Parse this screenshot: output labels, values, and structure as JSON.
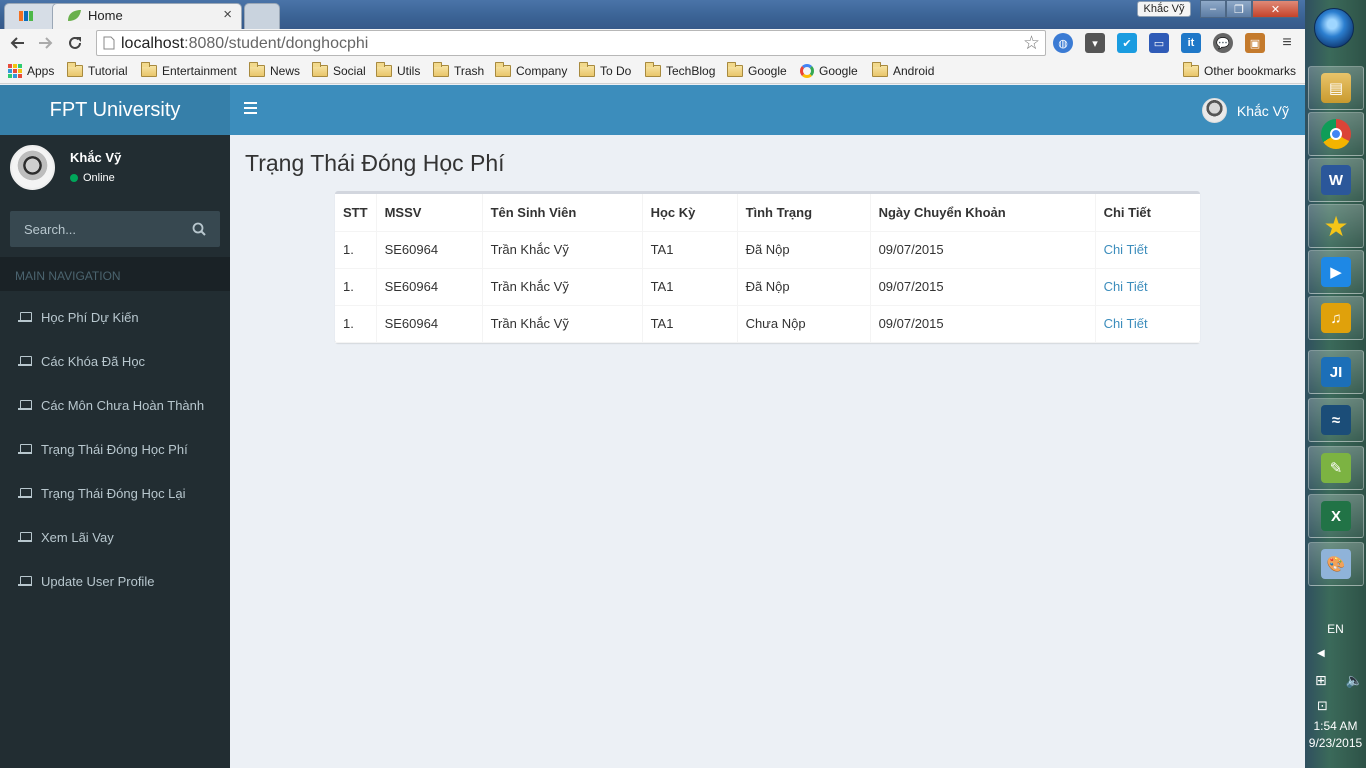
{
  "browser": {
    "tabs": [
      {
        "title": ""
      },
      {
        "title": "Home"
      },
      {
        "title": ""
      }
    ],
    "window_user": "Khắc Vỹ",
    "address": {
      "host": "localhost",
      "rest": ":8080/student/donghocphi"
    },
    "bookmarks": [
      {
        "label": "Apps",
        "icon": "apps-grid-icon"
      },
      {
        "label": "Tutorial",
        "icon": "folder-icon"
      },
      {
        "label": "Entertainment",
        "icon": "folder-icon"
      },
      {
        "label": "News",
        "icon": "folder-icon"
      },
      {
        "label": "Social",
        "icon": "folder-icon"
      },
      {
        "label": "Utils",
        "icon": "folder-icon"
      },
      {
        "label": "Trash",
        "icon": "folder-icon"
      },
      {
        "label": "Company",
        "icon": "folder-icon"
      },
      {
        "label": "To Do",
        "icon": "folder-icon"
      },
      {
        "label": "TechBlog",
        "icon": "folder-icon"
      },
      {
        "label": "Google",
        "icon": "folder-icon"
      },
      {
        "label": "Google",
        "icon": "google-icon"
      },
      {
        "label": "Android",
        "icon": "folder-icon"
      }
    ],
    "other_bookmarks": "Other bookmarks",
    "extension_icons": [
      "globe-icon",
      "pocket-icon",
      "check-icon",
      "screencast-icon",
      "it-icon",
      "chat-icon",
      "lock-icon",
      "menu-icon"
    ]
  },
  "app": {
    "brand": "FPT University",
    "top_user": "Khắc Vỹ",
    "colors": {
      "header": "#3c8dbc",
      "logo": "#367fa9",
      "sidebar": "#222d32",
      "link": "#3c8dbc",
      "online": "#00a65a"
    }
  },
  "sidebar": {
    "user_name": "Khắc Vỹ",
    "status": "Online",
    "search_placeholder": "Search...",
    "header": "MAIN NAVIGATION",
    "items": [
      {
        "label": "Học Phí Dự Kiến"
      },
      {
        "label": "Các Khóa Đã Học"
      },
      {
        "label": "Các Môn Chưa Hoàn Thành"
      },
      {
        "label": "Trạng Thái Đóng Học Phí"
      },
      {
        "label": "Trạng Thái Đóng Học Lại"
      },
      {
        "label": "Xem Lãi Vay"
      },
      {
        "label": "Update User Profile"
      }
    ]
  },
  "main": {
    "title": "Trạng Thái Đóng Học Phí",
    "columns": [
      "STT",
      "MSSV",
      "Tên Sinh Viên",
      "Học Kỳ",
      "Tình Trạng",
      "Ngày Chuyển Khoản",
      "Chi Tiết"
    ],
    "rows": [
      [
        "1.",
        "SE60964",
        "Trần Khắc Vỹ",
        "TA1",
        "Đã Nộp",
        "09/07/2015",
        "Chi Tiết"
      ],
      [
        "1.",
        "SE60964",
        "Trần Khắc Vỹ",
        "TA1",
        "Đã Nộp",
        "09/07/2015",
        "Chi Tiết"
      ],
      [
        "1.",
        "SE60964",
        "Trần Khắc Vỹ",
        "TA1",
        "Chưa Nộp",
        "09/07/2015",
        "Chi Tiết"
      ]
    ]
  },
  "taskbar": {
    "apps": [
      "file-manager-icon",
      "chrome-icon",
      "word-icon",
      "star-app-icon",
      "media-player-icon",
      "music-icon",
      "intellij-icon",
      "mysql-icon",
      "notepad-icon",
      "excel-icon",
      "paint-icon"
    ],
    "lang": "EN",
    "time": "1:54 AM",
    "date": "9/23/2015"
  }
}
